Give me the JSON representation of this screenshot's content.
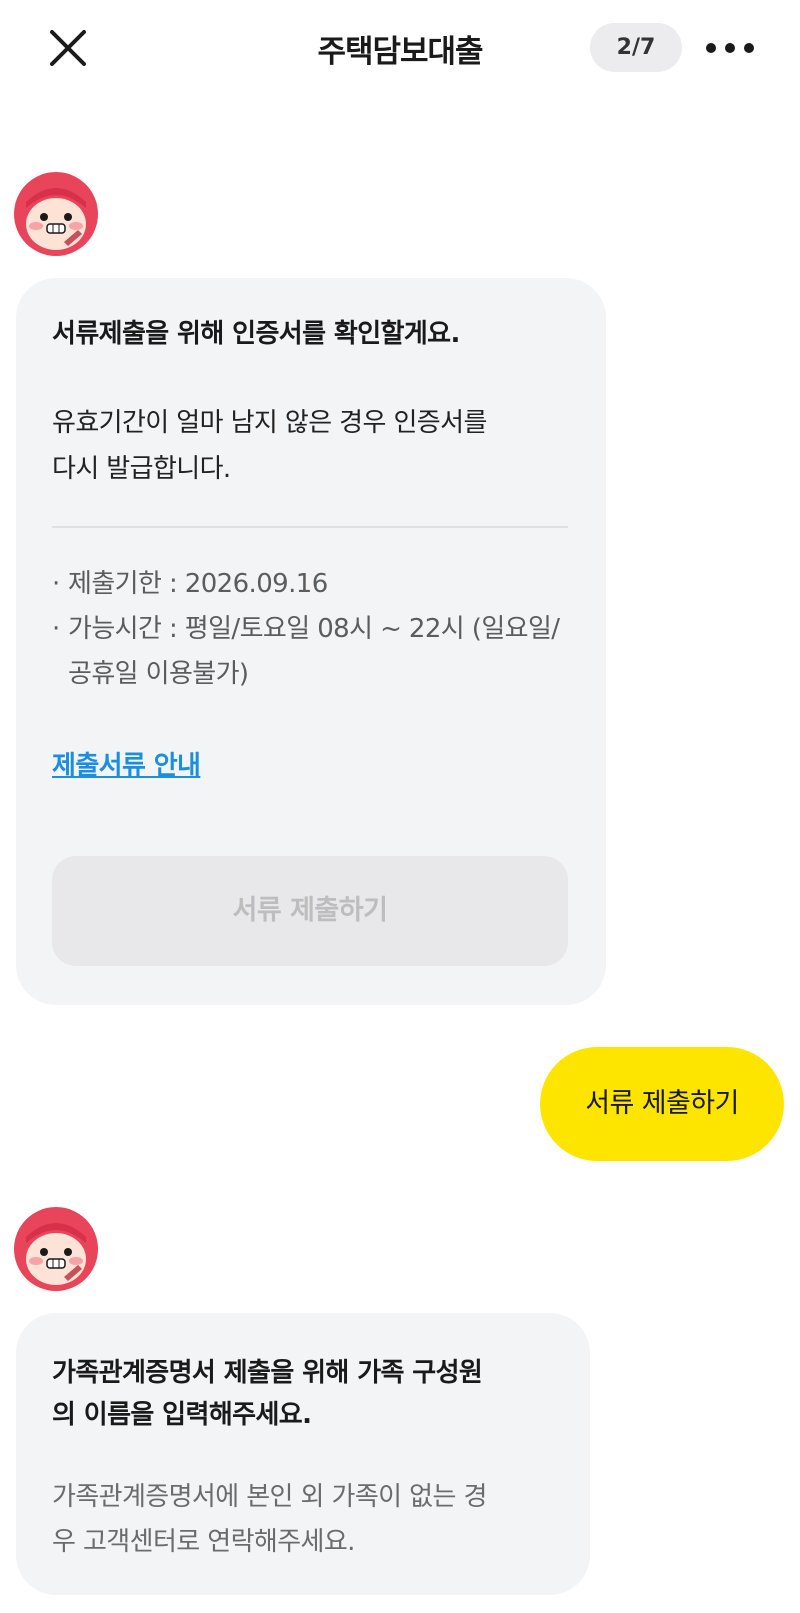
{
  "header": {
    "title": "주택담보대출",
    "step": "2/7"
  },
  "messages": {
    "first": {
      "heading": "서류제출을 위해 인증서를 확인할게요.",
      "body_line1": "유효기간이 얼마 남지 않은 경우 인증서를",
      "body_line2": "다시 발급합니다.",
      "details": [
        "제출기한 : 2026.09.16",
        "가능시간 : 평일/토요일 08시 ~ 22시 (일요일/공휴일 이용불가)"
      ],
      "detail_bullet": "·",
      "link": "제출서류 안내",
      "button": "서류 제출하기"
    },
    "user_reply": "서류 제출하기",
    "second": {
      "heading_line1": "가족관계증명서 제출을 위해 가족 구성원",
      "heading_line2": "의 이름을 입력해주세요.",
      "body_line1": "가족관계증명서에 본인 외 가족이 없는 경",
      "body_line2": "우 고객센터로 연락해주세요."
    }
  },
  "colors": {
    "accent_yellow": "#fee500",
    "link_blue": "#1a8fe0",
    "bubble_gray": "#f3f4f6",
    "avatar_red": "#e8445a"
  },
  "icons": {
    "close": "close-icon",
    "more": "more-icon",
    "avatar": "bot-avatar-icon"
  }
}
